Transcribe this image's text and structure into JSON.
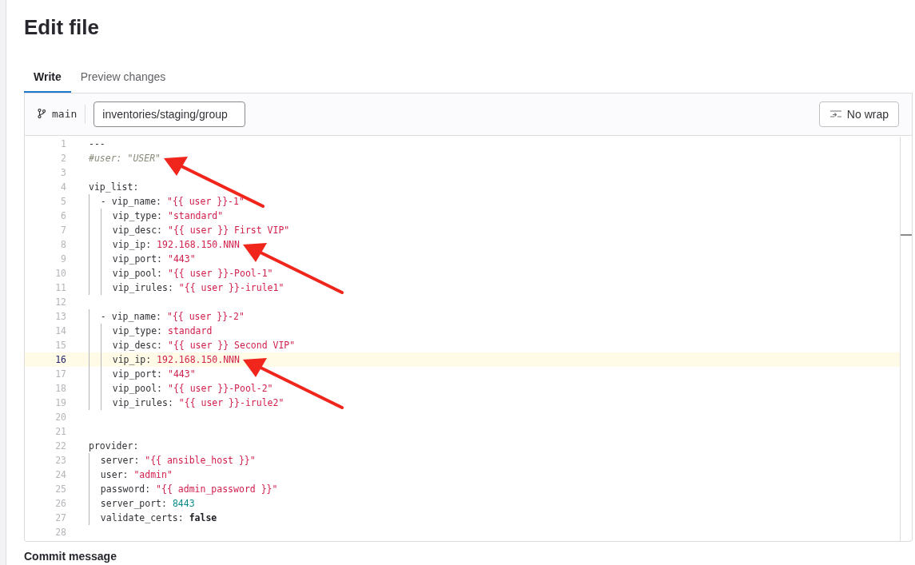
{
  "title": "Edit file",
  "tabs": [
    {
      "label": "Write",
      "selected": true
    },
    {
      "label": "Preview changes",
      "selected": false
    }
  ],
  "editor": {
    "branch": "main",
    "file_path": "inventories/staging/group",
    "wrap_button": "No wrap",
    "lines": [
      {
        "number": "1",
        "selected": false,
        "arrow": false,
        "tokens": [
          {
            "kind": "plain",
            "text": "---"
          }
        ]
      },
      {
        "number": "2",
        "selected": false,
        "arrow": true,
        "tokens": [
          {
            "kind": "comment",
            "text": "#user: \"USER\""
          }
        ]
      },
      {
        "number": "3",
        "selected": false,
        "arrow": false
      },
      {
        "number": "4",
        "selected": false,
        "arrow": false,
        "tokens": [
          {
            "kind": "plain",
            "text": "vip_list:"
          }
        ]
      },
      {
        "number": "5",
        "selected": false,
        "arrow": false,
        "tokens": [
          {
            "kind": "plain",
            "text": "  - vip_name: "
          },
          {
            "kind": "string",
            "text": "\"{{ user }}-1\""
          }
        ]
      },
      {
        "number": "6",
        "selected": false,
        "arrow": false,
        "tokens": [
          {
            "kind": "plain",
            "text": "    vip_type: "
          },
          {
            "kind": "string",
            "text": "\"standard\""
          }
        ]
      },
      {
        "number": "7",
        "selected": false,
        "arrow": false,
        "tokens": [
          {
            "kind": "plain",
            "text": "    vip_desc: "
          },
          {
            "kind": "string",
            "text": "\"{{ user }} First VIP\""
          }
        ]
      },
      {
        "number": "8",
        "selected": false,
        "arrow": true,
        "tokens": [
          {
            "kind": "plain",
            "text": "    vip_ip: "
          },
          {
            "kind": "string",
            "text": "192.168.150.NNN"
          }
        ]
      },
      {
        "number": "9",
        "selected": false,
        "arrow": false,
        "tokens": [
          {
            "kind": "plain",
            "text": "    vip_port: "
          },
          {
            "kind": "string",
            "text": "\"443\""
          }
        ]
      },
      {
        "number": "10",
        "selected": false,
        "arrow": false,
        "tokens": [
          {
            "kind": "plain",
            "text": "    vip_pool: "
          },
          {
            "kind": "string",
            "text": "\"{{ user }}-Pool-1\""
          }
        ]
      },
      {
        "number": "11",
        "selected": false,
        "arrow": false,
        "tokens": [
          {
            "kind": "plain",
            "text": "    vip_irules: "
          },
          {
            "kind": "string",
            "text": "\"{{ user }}-irule1\""
          }
        ]
      },
      {
        "number": "12",
        "selected": false,
        "arrow": false
      },
      {
        "number": "13",
        "selected": false,
        "arrow": false,
        "tokens": [
          {
            "kind": "plain",
            "text": "  - vip_name: "
          },
          {
            "kind": "string",
            "text": "\"{{ user }}-2\""
          }
        ]
      },
      {
        "number": "14",
        "selected": false,
        "arrow": false,
        "tokens": [
          {
            "kind": "plain",
            "text": "    vip_type: "
          },
          {
            "kind": "string",
            "text": "standard"
          }
        ]
      },
      {
        "number": "15",
        "selected": false,
        "arrow": false,
        "tokens": [
          {
            "kind": "plain",
            "text": "    vip_desc: "
          },
          {
            "kind": "string",
            "text": "\"{{ user }} Second VIP\""
          }
        ]
      },
      {
        "number": "16",
        "selected": true,
        "arrow": true,
        "tokens": [
          {
            "kind": "plain",
            "text": "    vip_ip: "
          },
          {
            "kind": "string",
            "text": "192.168.150.NNN"
          }
        ]
      },
      {
        "number": "17",
        "selected": false,
        "arrow": false,
        "tokens": [
          {
            "kind": "plain",
            "text": "    vip_port: "
          },
          {
            "kind": "string",
            "text": "\"443\""
          }
        ]
      },
      {
        "number": "18",
        "selected": false,
        "arrow": false,
        "tokens": [
          {
            "kind": "plain",
            "text": "    vip_pool: "
          },
          {
            "kind": "string",
            "text": "\"{{ user }}-Pool-2\""
          }
        ]
      },
      {
        "number": "19",
        "selected": false,
        "arrow": false,
        "tokens": [
          {
            "kind": "plain",
            "text": "    vip_irules: "
          },
          {
            "kind": "string",
            "text": "\"{{ user }}-irule2\""
          }
        ]
      },
      {
        "number": "20",
        "selected": false,
        "arrow": false
      },
      {
        "number": "21",
        "selected": false,
        "arrow": false
      },
      {
        "number": "22",
        "selected": false,
        "arrow": false,
        "tokens": [
          {
            "kind": "plain",
            "text": "provider:"
          }
        ]
      },
      {
        "number": "23",
        "selected": false,
        "arrow": false,
        "tokens": [
          {
            "kind": "plain",
            "text": "  server: "
          },
          {
            "kind": "string",
            "text": "\"{{ ansible_host }}\""
          }
        ]
      },
      {
        "number": "24",
        "selected": false,
        "arrow": false,
        "tokens": [
          {
            "kind": "plain",
            "text": "  user: "
          },
          {
            "kind": "string",
            "text": "\"admin\""
          }
        ]
      },
      {
        "number": "25",
        "selected": false,
        "arrow": false,
        "tokens": [
          {
            "kind": "plain",
            "text": "  password: "
          },
          {
            "kind": "string",
            "text": "\"{{ admin_password }}\""
          }
        ]
      },
      {
        "number": "26",
        "selected": false,
        "arrow": false,
        "tokens": [
          {
            "kind": "plain",
            "text": "  server_port: "
          },
          {
            "kind": "number",
            "text": "8443"
          }
        ]
      },
      {
        "number": "27",
        "selected": false,
        "arrow": false,
        "tokens": [
          {
            "kind": "plain",
            "text": "  validate_certs: "
          },
          {
            "kind": "bool",
            "text": "false"
          }
        ]
      },
      {
        "number": "28",
        "selected": false,
        "arrow": false
      }
    ]
  },
  "commit_label": "Commit message"
}
